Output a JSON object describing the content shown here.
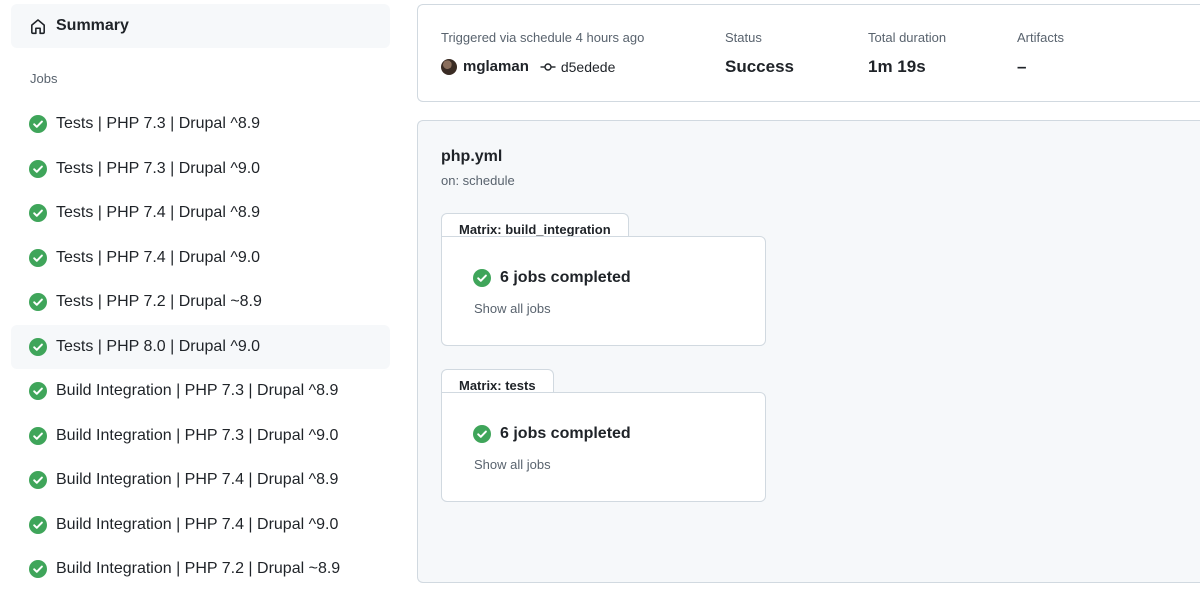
{
  "sidebar": {
    "summary_label": "Summary",
    "jobs_heading": "Jobs",
    "jobs": [
      {
        "label": "Tests | PHP 7.3 | Drupal ^8.9",
        "status": "success"
      },
      {
        "label": "Tests | PHP 7.3 | Drupal ^9.0",
        "status": "success"
      },
      {
        "label": "Tests | PHP 7.4 | Drupal ^8.9",
        "status": "success"
      },
      {
        "label": "Tests | PHP 7.4 | Drupal ^9.0",
        "status": "success"
      },
      {
        "label": "Tests | PHP 7.2 | Drupal ~8.9",
        "status": "success"
      },
      {
        "label": "Tests | PHP 8.0 | Drupal ^9.0",
        "status": "success",
        "highlighted": true
      },
      {
        "label": "Build Integration | PHP 7.3 | Drupal ^8.9",
        "status": "success"
      },
      {
        "label": "Build Integration | PHP 7.3 | Drupal ^9.0",
        "status": "success"
      },
      {
        "label": "Build Integration | PHP 7.4 | Drupal ^8.9",
        "status": "success"
      },
      {
        "label": "Build Integration | PHP 7.4 | Drupal ^9.0",
        "status": "success"
      },
      {
        "label": "Build Integration | PHP 7.2 | Drupal ~8.9",
        "status": "success"
      }
    ]
  },
  "run_info": {
    "trigger_label": "Triggered via schedule 4 hours ago",
    "actor": "mglaman",
    "commit": "d5edede",
    "status_label": "Status",
    "status_value": "Success",
    "duration_label": "Total duration",
    "duration_value": "1m 19s",
    "artifacts_label": "Artifacts",
    "artifacts_value": "–"
  },
  "workflow": {
    "file": "php.yml",
    "trigger": "on: schedule",
    "matrices": [
      {
        "name": "Matrix: build_integration",
        "summary": "6 jobs completed",
        "link": "Show all jobs"
      },
      {
        "name": "Matrix: tests",
        "summary": "6 jobs completed",
        "link": "Show all jobs"
      }
    ]
  },
  "colors": {
    "success": "#3fa55a",
    "muted_text": "#59636e",
    "border": "#d1d9e0",
    "subtle_bg": "#f6f8fa"
  },
  "icons": {
    "summary": "home-icon",
    "job_status": "check-circle-icon",
    "commit": "git-commit-icon"
  }
}
